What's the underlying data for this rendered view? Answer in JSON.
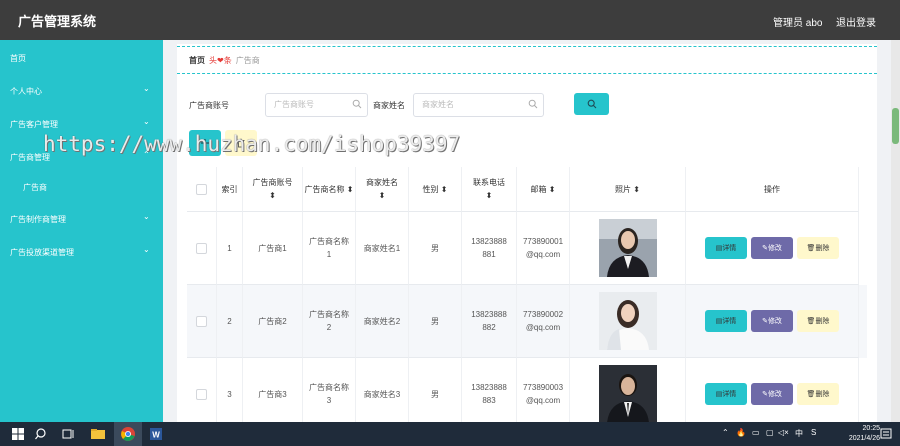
{
  "header": {
    "app_title": "广告管理系统",
    "admin_label": "管理员 abo",
    "logout_label": "退出登录"
  },
  "sidebar": {
    "items": [
      {
        "label": "首页",
        "has_arrow": false
      },
      {
        "label": "个人中心",
        "has_arrow": true
      },
      {
        "label": "广告客户管理",
        "has_arrow": true
      },
      {
        "label": "广告商管理",
        "has_arrow": true
      },
      {
        "label": "广告商",
        "has_arrow": false,
        "sub": true
      },
      {
        "label": "广告制作商管理",
        "has_arrow": true
      },
      {
        "label": "广告投放渠道管理",
        "has_arrow": true
      }
    ]
  },
  "breadcrumb": {
    "home": "首页",
    "separator": "头❤条",
    "current": "广告商"
  },
  "search": {
    "account_label": "广告商账号",
    "account_placeholder": "广告商账号",
    "merchant_label": "商家姓名",
    "merchant_placeholder": "商家姓名"
  },
  "table": {
    "headers": {
      "index": "索引",
      "account": "广告商账号",
      "name": "广告商名称",
      "merchant": "商家姓名",
      "gender": "性别",
      "phone": "联系电话",
      "email": "邮箱",
      "photo": "照片",
      "actions": "操作"
    },
    "rows": [
      {
        "index": "1",
        "account": "广告商1",
        "name": "广告商名称1",
        "merchant": "商家姓名1",
        "gender": "男",
        "phone": "13823888881",
        "email": "773890001@qq.com"
      },
      {
        "index": "2",
        "account": "广告商2",
        "name": "广告商名称2",
        "merchant": "商家姓名2",
        "gender": "男",
        "phone": "13823888882",
        "email": "773890002@qq.com"
      },
      {
        "index": "3",
        "account": "广告商3",
        "name": "广告商名称3",
        "merchant": "商家姓名3",
        "gender": "男",
        "phone": "13823888883",
        "email": "773890003@qq.com"
      }
    ],
    "actions": {
      "detail": "详情",
      "edit": "修改",
      "remove": "删除"
    }
  },
  "watermark": "https://www.huzhan.com/ishop39397",
  "taskbar": {
    "time": "20:25",
    "date": "2021/4/26",
    "ime": "中"
  },
  "colors": {
    "accent": "#26c4cc",
    "header_bg": "#3d3d3d",
    "edit_btn": "#6e6aa8",
    "delete_btn": "#fff8cc"
  }
}
